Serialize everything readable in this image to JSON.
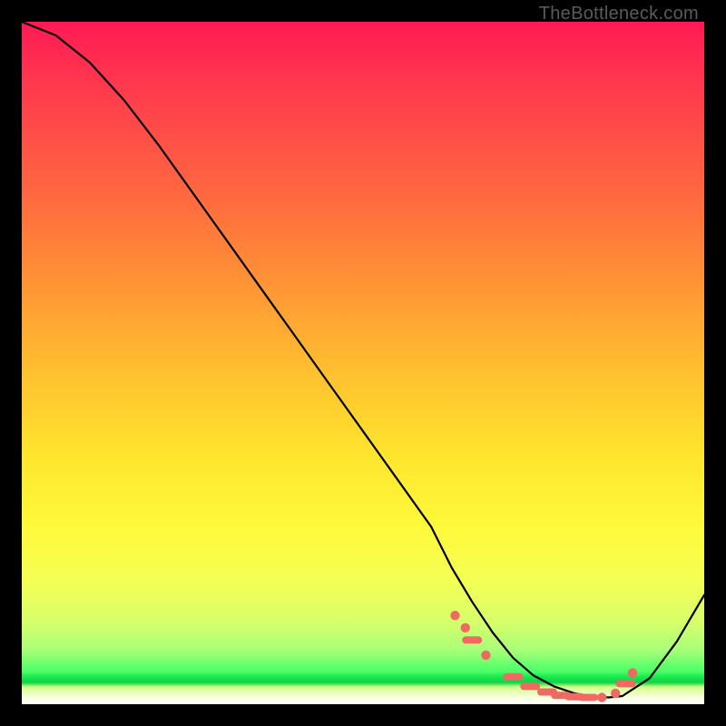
{
  "watermark": "TheBottleneck.com",
  "chart_data": {
    "type": "line",
    "title": "",
    "xlabel": "",
    "ylabel": "",
    "xlim": [
      0,
      100
    ],
    "ylim": [
      0,
      100
    ],
    "grid": false,
    "series": [
      {
        "name": "bottleneck-curve",
        "x": [
          0,
          5,
          10,
          15,
          20,
          25,
          30,
          35,
          40,
          45,
          50,
          55,
          60,
          63,
          66,
          69,
          72,
          75,
          78,
          81,
          84,
          86,
          88,
          92,
          96,
          100
        ],
        "y": [
          100,
          98,
          94,
          88.5,
          82,
          75,
          68,
          61,
          54,
          47,
          40,
          33,
          26,
          20,
          15,
          10.5,
          6.8,
          4.2,
          2.6,
          1.6,
          1.1,
          1.0,
          1.2,
          3.8,
          9.2,
          16
        ]
      }
    ],
    "markers": {
      "name": "highlight-dots",
      "color": "#ef6a63",
      "points": [
        {
          "x": 63.5,
          "y": 13.0,
          "kind": "dot"
        },
        {
          "x": 65.0,
          "y": 11.2,
          "kind": "dot"
        },
        {
          "x": 66.0,
          "y": 9.4,
          "kind": "dash"
        },
        {
          "x": 68.0,
          "y": 7.2,
          "kind": "dot"
        },
        {
          "x": 72.0,
          "y": 4.0,
          "kind": "dash"
        },
        {
          "x": 74.5,
          "y": 2.6,
          "kind": "dash"
        },
        {
          "x": 77.0,
          "y": 1.8,
          "kind": "dash"
        },
        {
          "x": 79.0,
          "y": 1.3,
          "kind": "dash"
        },
        {
          "x": 81.0,
          "y": 1.1,
          "kind": "dash"
        },
        {
          "x": 83.0,
          "y": 1.0,
          "kind": "dash"
        },
        {
          "x": 85.0,
          "y": 1.0,
          "kind": "dot"
        },
        {
          "x": 87.0,
          "y": 1.6,
          "kind": "dot"
        },
        {
          "x": 88.5,
          "y": 3.0,
          "kind": "dash"
        },
        {
          "x": 89.5,
          "y": 4.6,
          "kind": "dot"
        }
      ]
    }
  }
}
